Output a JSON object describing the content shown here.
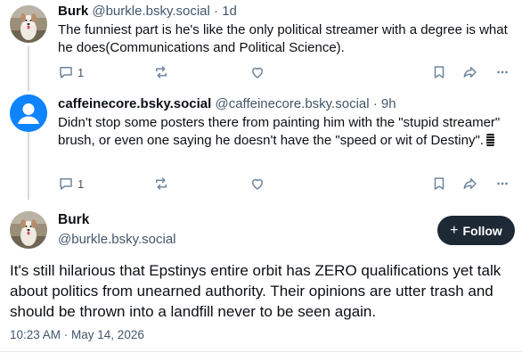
{
  "posts": [
    {
      "name": "Burk",
      "handle": "@burkle.bsky.social",
      "sep": "·",
      "time": "1d",
      "text": "The funniest part is he's like the only political streamer with a degree is what he does(Communications and Political Science).",
      "reply_count": "1",
      "avatar": "dog-avatar"
    },
    {
      "name": "caffeinecore.bsky.social",
      "handle": "@caffeinecore.bsky.social",
      "sep": "·",
      "time": "9h",
      "text": "Didn't stop some posters there from painting him with the \"stupid streamer\" brush, or even one saying he doesn't have the \"speed or wit of Destiny\".",
      "reply_count": "1",
      "avatar": "default-user-avatar"
    }
  ],
  "main_post": {
    "name": "Burk",
    "handle": "@burkle.bsky.social",
    "follow_label": "Follow",
    "follow_icon": "+",
    "text": "It's still hilarious that Epstinys entire orbit has ZERO qualifications yet talk about politics from unearned authority.  Their opinions are utter trash and should be thrown into a landfill never to be seen again.",
    "timestamp": "10:23 AM · May 14, 2026"
  },
  "colors": {
    "text": "#0b0f14",
    "muted": "#42576c",
    "icon": "#6f869f",
    "follow_bg": "#1e2936",
    "default_avatar": "#1083fe",
    "divider": "#e4e8ec"
  }
}
